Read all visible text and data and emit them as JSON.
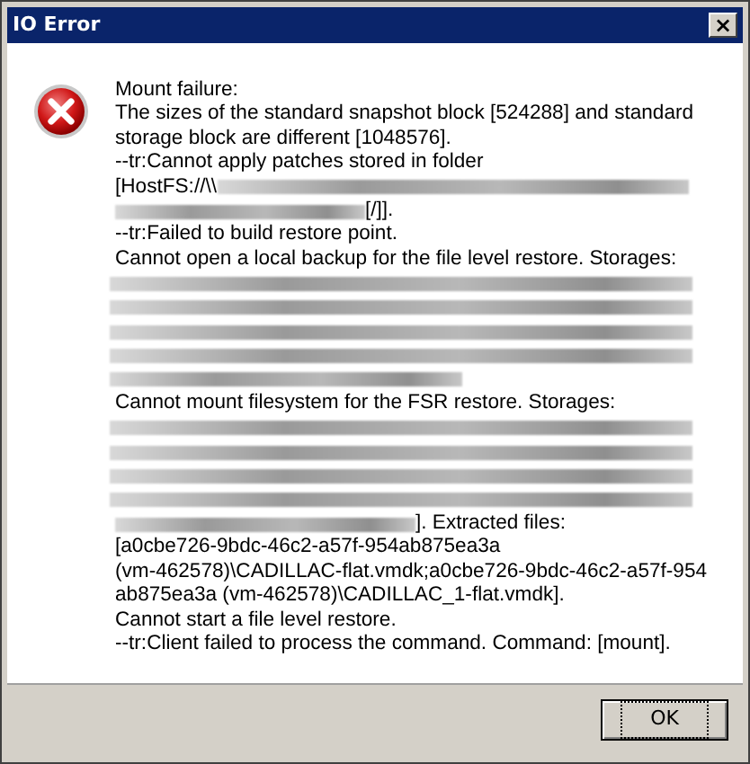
{
  "window": {
    "title": "IO Error",
    "close": "×"
  },
  "message": {
    "lines": [
      {
        "kind": "text",
        "text": "Mount failure:"
      },
      {
        "kind": "text",
        "text": "The sizes of the standard snapshot block [524288] and standard"
      },
      {
        "kind": "text",
        "text": "storage block are different [1048576]."
      },
      {
        "kind": "text",
        "text": "--tr:Cannot apply patches stored in folder"
      },
      {
        "kind": "text_then_redacted",
        "text": "[HostFS://\\\\"
      },
      {
        "kind": "redacted_then_text",
        "text": "[/]]."
      },
      {
        "kind": "text",
        "text": "--tr:Failed to build restore point."
      },
      {
        "kind": "text",
        "text": "Cannot open a local backup for the file level restore. Storages:"
      },
      {
        "kind": "redacted"
      },
      {
        "kind": "redacted"
      },
      {
        "kind": "redacted"
      },
      {
        "kind": "redacted"
      },
      {
        "kind": "redacted_short"
      },
      {
        "kind": "text",
        "text": "Cannot mount filesystem for the FSR restore.  Storages:"
      },
      {
        "kind": "redacted"
      },
      {
        "kind": "redacted"
      },
      {
        "kind": "redacted"
      },
      {
        "kind": "redacted"
      },
      {
        "kind": "redacted_then_text",
        "text": "]. Extracted files:"
      },
      {
        "kind": "text",
        "text": "[a0cbe726-9bdc-46c2-a57f-954ab875ea3a"
      },
      {
        "kind": "text",
        "text": "(vm-462578)\\CADILLAC-flat.vmdk;a0cbe726-9bdc-46c2-a57f-954"
      },
      {
        "kind": "text",
        "text": "ab875ea3a (vm-462578)\\CADILLAC_1-flat.vmdk]."
      },
      {
        "kind": "text",
        "text": "Cannot start a file level restore."
      },
      {
        "kind": "text",
        "text": "--tr:Client failed to process the command. Command: [mount]."
      }
    ]
  },
  "buttons": [
    {
      "label": "OK",
      "focused": true
    }
  ]
}
